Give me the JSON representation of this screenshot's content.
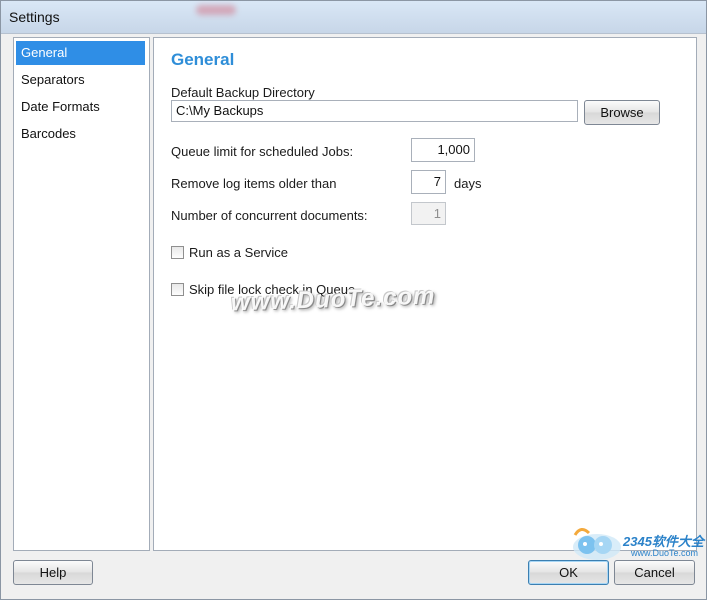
{
  "window": {
    "title": "Settings"
  },
  "sidebar": {
    "items": [
      {
        "label": "General",
        "active": true
      },
      {
        "label": "Separators",
        "active": false
      },
      {
        "label": "Date Formats",
        "active": false
      },
      {
        "label": "Barcodes",
        "active": false
      }
    ]
  },
  "general": {
    "heading": "General",
    "backup_dir_label": "Default Backup Directory",
    "backup_dir_value": "C:\\My Backups",
    "browse_label": "Browse",
    "queue_limit_label": "Queue limit for scheduled Jobs:",
    "queue_limit_value": "1,000",
    "remove_log_label": "Remove log items older than",
    "remove_log_value": "7",
    "remove_log_unit": "days",
    "concurrent_label": "Number of concurrent documents:",
    "concurrent_value": "1",
    "run_service_label": "Run as a Service",
    "run_service_checked": false,
    "skip_lock_label": "Skip file lock check in Queue",
    "skip_lock_checked": false
  },
  "footer": {
    "help_label": "Help",
    "ok_label": "OK",
    "cancel_label": "Cancel"
  },
  "watermarks": {
    "center": "www.DuoTe.com",
    "corner_brand": "2345软件大全",
    "corner_url": "www.DuoTe.com"
  },
  "colors": {
    "accent": "#2f8ee6",
    "heading": "#2f8ed8"
  }
}
